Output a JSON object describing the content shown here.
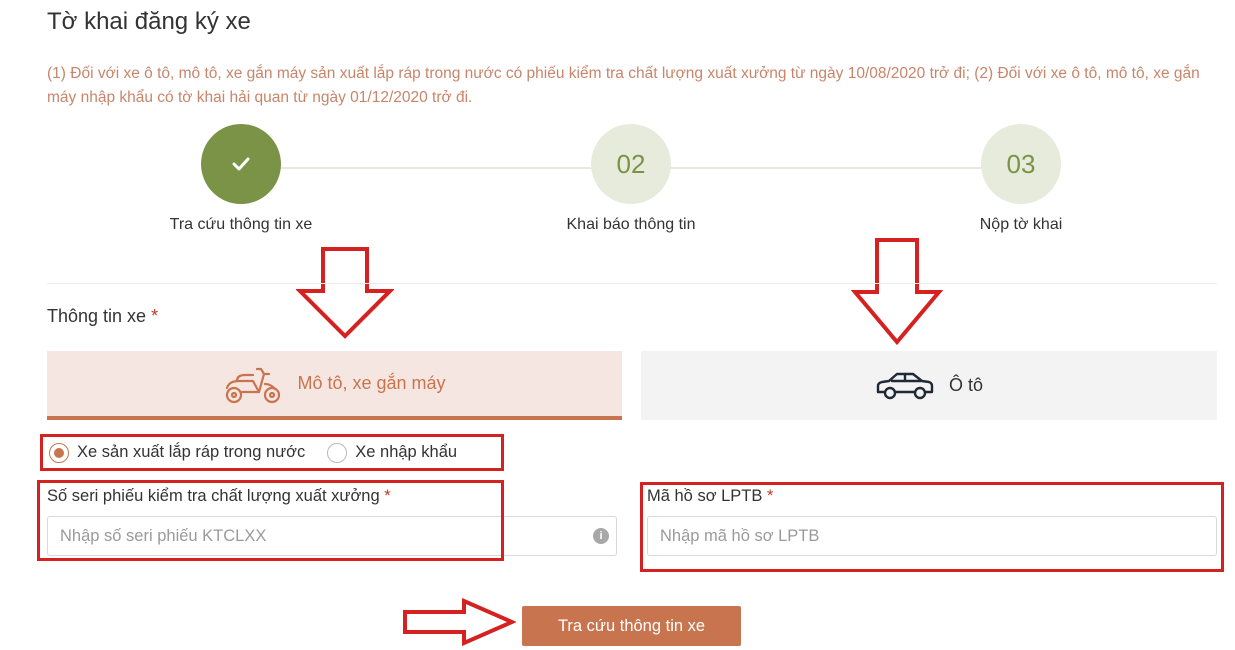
{
  "page": {
    "title": "Tờ khai đăng ký xe",
    "notice": "(1) Đối với xe ô tô, mô tô, xe gắn máy sản xuất lắp ráp trong nước có phiếu kiểm tra chất lượng xuất xưởng từ ngày 10/08/2020 trở đi; (2) Đối với xe ô tô, mô tô, xe gắn máy nhập khẩu có tờ khai hải quan từ ngày 01/12/2020 trở đi."
  },
  "steps": [
    {
      "number": "",
      "label": "Tra cứu thông tin xe",
      "status": "done"
    },
    {
      "number": "02",
      "label": "Khai báo thông tin",
      "status": "pending"
    },
    {
      "number": "03",
      "label": "Nộp tờ khai",
      "status": "pending"
    }
  ],
  "vehicle_info": {
    "label": "Thông tin xe",
    "required_mark": "*",
    "tabs": [
      {
        "label": "Mô tô, xe gắn máy",
        "icon": "motorbike-icon",
        "selected": true
      },
      {
        "label": "Ô tô",
        "icon": "car-icon",
        "selected": false
      }
    ]
  },
  "origin_options": [
    {
      "label": "Xe sản xuất lắp ráp trong nước",
      "checked": true
    },
    {
      "label": "Xe nhập khẩu",
      "checked": false
    }
  ],
  "fields": {
    "serial": {
      "label": "Số seri phiếu kiểm tra chất lượng xuất xưởng",
      "required_mark": "*",
      "value": "",
      "placeholder": "Nhập số seri phiếu KTCLXX",
      "info_glyph": "i"
    },
    "lptb": {
      "label": "Mã hồ sơ LPTB",
      "required_mark": "*",
      "value": "",
      "placeholder": "Nhập mã hồ sơ LPTB"
    }
  },
  "submit": {
    "label": "Tra cứu thông tin xe"
  },
  "colors": {
    "accent": "#c8754f",
    "notice": "#c8856a",
    "step_done": "#7a9347",
    "step_pending": "#e7ebdc",
    "annotation_red": "#d62121"
  }
}
